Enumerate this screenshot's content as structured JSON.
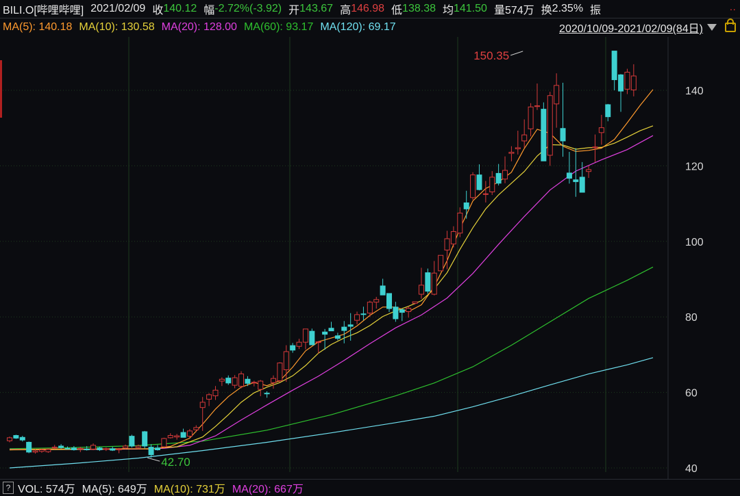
{
  "header": {
    "symbol": "BILI.O[哔哩哔哩]",
    "date": "2021/02/09",
    "close_label": "收",
    "close_value": "140.12",
    "change_label": "幅",
    "change_value": "-2.72%(-3.92)",
    "open_label": "开",
    "open_value": "143.67",
    "high_label": "高",
    "high_value": "146.98",
    "low_label": "低",
    "low_value": "138.38",
    "avg_label": "均",
    "avg_value": "141.50",
    "volume_label": "量",
    "volume_value": "574万",
    "turnover_label": "换",
    "turnover_value": "2.35%",
    "amplitude_label": "振",
    "more_dots": "··"
  },
  "ma_legend": {
    "ma5": "MA(5): 140.18",
    "ma10": "MA(10): 130.58",
    "ma20": "MA(20): 128.00",
    "ma60": "MA(60): 93.17",
    "ma120": "MA(120): 69.17",
    "range": "2020/10/09-2021/02/09(84日)"
  },
  "volume_legend": {
    "help": "?",
    "vol": "VOL: 574万",
    "ma5": "MA(5): 649万",
    "ma10": "MA(10): 731万",
    "ma20": "MA(20): 667万"
  },
  "colors": {
    "up": "#d63a3a",
    "down": "#3ed0d0",
    "ma5": "#ff9a2e",
    "ma10": "#e6d23a",
    "ma20": "#e040e0",
    "ma60": "#2ec02e",
    "ma120": "#70e0f0",
    "label_green": "#3cc63c",
    "label_red": "#e04040",
    "grid": "#1f3a1f"
  },
  "chart_data": {
    "type": "candlestick",
    "ylim": [
      39,
      150.5
    ],
    "yticks": [
      40,
      60,
      80,
      100,
      120,
      140
    ],
    "annotations": [
      {
        "text": "150.35",
        "value": 150.35,
        "index": 80
      },
      {
        "text": "42.70",
        "value": 42.7,
        "index": 21
      }
    ],
    "candles": [
      [
        47.2,
        48.3,
        46.8,
        48.0
      ],
      [
        48.6,
        48.8,
        47.7,
        47.9
      ],
      [
        48.1,
        48.5,
        47.0,
        47.4
      ],
      [
        46.8,
        47.0,
        43.9,
        44.2
      ],
      [
        44.2,
        45.0,
        43.8,
        44.5
      ],
      [
        44.4,
        45.1,
        44.0,
        44.8
      ],
      [
        44.3,
        45.2,
        44.0,
        44.9
      ],
      [
        45.3,
        46.1,
        45.0,
        45.5
      ],
      [
        45.8,
        46.3,
        45.1,
        45.4
      ],
      [
        45.2,
        45.7,
        44.9,
        45.1
      ],
      [
        45.3,
        45.8,
        44.6,
        44.8
      ],
      [
        45.0,
        45.6,
        44.2,
        45.2
      ],
      [
        45.0,
        45.8,
        44.6,
        44.8
      ],
      [
        45.0,
        46.5,
        44.7,
        46.0
      ],
      [
        45.3,
        45.6,
        44.5,
        44.8
      ],
      [
        44.9,
        45.4,
        44.5,
        45.1
      ],
      [
        45.1,
        45.6,
        44.5,
        44.7
      ],
      [
        44.8,
        45.3,
        43.9,
        45.0
      ],
      [
        45.3,
        46.2,
        45.0,
        45.8
      ],
      [
        48.4,
        48.8,
        45.4,
        45.8
      ],
      [
        45.4,
        46.2,
        45.0,
        45.8
      ],
      [
        49.6,
        49.8,
        45.2,
        45.8
      ],
      [
        45.5,
        46.3,
        42.7,
        43.5
      ],
      [
        45.3,
        46.1,
        44.6,
        44.8
      ],
      [
        45.6,
        48.0,
        45.3,
        47.8
      ],
      [
        48.0,
        49.2,
        47.8,
        48.6
      ],
      [
        48.2,
        49.0,
        47.5,
        48.5
      ],
      [
        49.4,
        50.4,
        48.4,
        48.1
      ],
      [
        48.4,
        50.3,
        48.0,
        49.8
      ],
      [
        50.1,
        51.3,
        49.5,
        50.7
      ],
      [
        56.0,
        58.8,
        49.8,
        57.4
      ],
      [
        58.2,
        59.8,
        56.4,
        59.4
      ],
      [
        59.1,
        61.7,
        58.0,
        60.6
      ],
      [
        63.0,
        64.0,
        61.7,
        63.5
      ],
      [
        63.8,
        64.5,
        62.0,
        62.5
      ],
      [
        61.9,
        64.6,
        61.1,
        63.9
      ],
      [
        61.6,
        65.6,
        61.1,
        64.9
      ],
      [
        63.5,
        64.3,
        61.7,
        62.4
      ],
      [
        62.7,
        63.1,
        61.6,
        62.7
      ],
      [
        60.8,
        63.3,
        59.0,
        63.0
      ],
      [
        59.8,
        60.3,
        58.6,
        59.7
      ],
      [
        62.6,
        64.5,
        61.0,
        63.7
      ],
      [
        63.1,
        68.0,
        62.7,
        67.8
      ],
      [
        66.0,
        72.5,
        62.8,
        70.8
      ],
      [
        72.4,
        73.1,
        70.5,
        71.2
      ],
      [
        72.2,
        74.2,
        71.5,
        73.3
      ],
      [
        73.3,
        76.8,
        71.4,
        76.8
      ],
      [
        76.2,
        76.9,
        72.6,
        72.6
      ],
      [
        73.4,
        73.6,
        70.3,
        73.4
      ],
      [
        76.0,
        76.8,
        71.3,
        75.4
      ],
      [
        77.0,
        78.7,
        76.3,
        76.3
      ],
      [
        75.0,
        75.8,
        73.8,
        74.3
      ],
      [
        77.3,
        78.9,
        73.0,
        76.4
      ],
      [
        77.9,
        81.0,
        73.7,
        77.5
      ],
      [
        79.1,
        81.4,
        78.0,
        80.6
      ],
      [
        80.8,
        82.7,
        79.1,
        80.7
      ],
      [
        81.0,
        84.3,
        80.0,
        83.9
      ],
      [
        83.9,
        85.3,
        82.2,
        84.6
      ],
      [
        88.2,
        90.1,
        86.1,
        85.8
      ],
      [
        86.2,
        86.2,
        81.3,
        82.2
      ],
      [
        82.6,
        84.0,
        78.7,
        79.5
      ],
      [
        81.9,
        82.2,
        78.9,
        81.2
      ],
      [
        81.4,
        82.8,
        79.8,
        82.3
      ],
      [
        83.6,
        83.9,
        83.3,
        84.0
      ],
      [
        86.0,
        93.0,
        84.8,
        88.4
      ],
      [
        91.7,
        92.8,
        86.1,
        86.8
      ],
      [
        86.0,
        94.8,
        85.7,
        91.6
      ],
      [
        92.2,
        96.3,
        92.7,
        96.3
      ],
      [
        97.7,
        102.8,
        92.6,
        100.7
      ],
      [
        99.3,
        104.0,
        98.4,
        102.6
      ],
      [
        102.2,
        109.0,
        101.1,
        107.5
      ],
      [
        110.2,
        113.4,
        106.0,
        108.6
      ],
      [
        111.6,
        118.3,
        111.0,
        117.6
      ],
      [
        117.6,
        120.4,
        113.5,
        113.7
      ],
      [
        112.5,
        116.0,
        110.3,
        112.6
      ],
      [
        113.1,
        118.6,
        112.3,
        117.0
      ],
      [
        118.0,
        120.5,
        114.8,
        115.4
      ],
      [
        116.5,
        122.5,
        115.4,
        118.8
      ],
      [
        123.3,
        125.2,
        121.2,
        123.6
      ],
      [
        124.5,
        129.3,
        123.0,
        124.8
      ],
      [
        126.6,
        132.3,
        124.8,
        128.2
      ],
      [
        129.8,
        136.6,
        127.8,
        135.6
      ],
      [
        135.7,
        141.8,
        134.8,
        135.9
      ],
      [
        135.0,
        136.8,
        121.4,
        121.3
      ],
      [
        122.8,
        139.6,
        120.0,
        138.6
      ],
      [
        136.4,
        144.5,
        130.1,
        141.3
      ],
      [
        129.9,
        142.0,
        122.4,
        126.6
      ],
      [
        118.1,
        123.7,
        115.3,
        116.7
      ],
      [
        116.3,
        124.7,
        111.8,
        115.8
      ],
      [
        117.0,
        121.0,
        113.8,
        113.0
      ],
      [
        118.5,
        120.0,
        116.8,
        119.0
      ],
      [
        124.8,
        128.3,
        121.0,
        125.0
      ],
      [
        128.8,
        133.5,
        125.6,
        130.1
      ],
      [
        136.2,
        136.4,
        131.8,
        133.0
      ],
      [
        150.4,
        149.4,
        140.0,
        142.8
      ],
      [
        144.1,
        144.3,
        134.3,
        139.8
      ],
      [
        140.3,
        145.7,
        139.0,
        144.8
      ],
      [
        140.1,
        146.9,
        138.4,
        143.8
      ]
    ],
    "ma5": [
      [
        0,
        44.8
      ],
      [
        6,
        45.0
      ],
      [
        12,
        45.0
      ],
      [
        18,
        45.1
      ],
      [
        22,
        45.0
      ],
      [
        25,
        45.7
      ],
      [
        28,
        47.9
      ],
      [
        30,
        51.6
      ],
      [
        32,
        55.6
      ],
      [
        34,
        58.9
      ],
      [
        36,
        61.4
      ],
      [
        38,
        62.6
      ],
      [
        40,
        61.8
      ],
      [
        42,
        63.1
      ],
      [
        44,
        66.7
      ],
      [
        46,
        71.0
      ],
      [
        48,
        73.4
      ],
      [
        50,
        74.4
      ],
      [
        52,
        75.4
      ],
      [
        54,
        77.6
      ],
      [
        56,
        80.4
      ],
      [
        58,
        82.6
      ],
      [
        60,
        82.6
      ],
      [
        62,
        81.4
      ],
      [
        64,
        83.2
      ],
      [
        66,
        88.0
      ],
      [
        68,
        94.9
      ],
      [
        70,
        103.4
      ],
      [
        72,
        110.7
      ],
      [
        74,
        114.0
      ],
      [
        76,
        115.7
      ],
      [
        78,
        118.3
      ],
      [
        80,
        124.6
      ],
      [
        82,
        129.7
      ],
      [
        84,
        128.6
      ],
      [
        86,
        125.2
      ],
      [
        88,
        123.8
      ],
      [
        90,
        124.1
      ],
      [
        92,
        124.7
      ],
      [
        94,
        127.0
      ],
      [
        96,
        131.4
      ],
      [
        98,
        136.0
      ],
      [
        100,
        140.2
      ]
    ],
    "ma10": [
      [
        0,
        44.8
      ],
      [
        8,
        44.9
      ],
      [
        16,
        45.0
      ],
      [
        22,
        45.1
      ],
      [
        26,
        45.6
      ],
      [
        30,
        48.2
      ],
      [
        32,
        51.0
      ],
      [
        34,
        54.1
      ],
      [
        36,
        57.4
      ],
      [
        38,
        59.9
      ],
      [
        40,
        61.4
      ],
      [
        42,
        62.6
      ],
      [
        44,
        64.4
      ],
      [
        46,
        67.1
      ],
      [
        48,
        70.4
      ],
      [
        50,
        72.7
      ],
      [
        52,
        74.4
      ],
      [
        54,
        75.8
      ],
      [
        56,
        77.7
      ],
      [
        58,
        80.1
      ],
      [
        60,
        81.6
      ],
      [
        62,
        82.8
      ],
      [
        64,
        84.3
      ],
      [
        66,
        87.4
      ],
      [
        68,
        91.7
      ],
      [
        70,
        97.9
      ],
      [
        72,
        103.6
      ],
      [
        74,
        108.6
      ],
      [
        76,
        112.3
      ],
      [
        78,
        115.4
      ],
      [
        80,
        118.5
      ],
      [
        82,
        122.6
      ],
      [
        84,
        125.6
      ],
      [
        86,
        125.5
      ],
      [
        88,
        124.4
      ],
      [
        90,
        124.8
      ],
      [
        92,
        124.9
      ],
      [
        94,
        126.0
      ],
      [
        96,
        127.6
      ],
      [
        98,
        129.3
      ],
      [
        100,
        130.6
      ]
    ],
    "ma20": [
      [
        0,
        44.9
      ],
      [
        10,
        44.9
      ],
      [
        20,
        45.0
      ],
      [
        24,
        45.2
      ],
      [
        28,
        46.0
      ],
      [
        32,
        48.5
      ],
      [
        36,
        52.7
      ],
      [
        40,
        56.7
      ],
      [
        44,
        60.6
      ],
      [
        48,
        64.3
      ],
      [
        52,
        68.5
      ],
      [
        56,
        72.9
      ],
      [
        60,
        77.1
      ],
      [
        64,
        80.5
      ],
      [
        68,
        85.0
      ],
      [
        72,
        91.5
      ],
      [
        76,
        99.2
      ],
      [
        80,
        106.6
      ],
      [
        84,
        113.6
      ],
      [
        88,
        118.6
      ],
      [
        92,
        121.6
      ],
      [
        96,
        124.3
      ],
      [
        100,
        128.0
      ]
    ],
    "ma60": [
      [
        0,
        45.1
      ],
      [
        10,
        45.4
      ],
      [
        20,
        45.9
      ],
      [
        30,
        47.1
      ],
      [
        40,
        50.0
      ],
      [
        50,
        54.1
      ],
      [
        60,
        59.1
      ],
      [
        66,
        62.5
      ],
      [
        72,
        66.8
      ],
      [
        78,
        72.5
      ],
      [
        84,
        78.7
      ],
      [
        90,
        84.9
      ],
      [
        96,
        89.7
      ],
      [
        100,
        93.2
      ]
    ],
    "ma120": [
      [
        0,
        40.0
      ],
      [
        10,
        41.2
      ],
      [
        20,
        42.6
      ],
      [
        30,
        44.6
      ],
      [
        40,
        46.8
      ],
      [
        50,
        49.3
      ],
      [
        60,
        52.0
      ],
      [
        66,
        53.7
      ],
      [
        72,
        56.2
      ],
      [
        78,
        59.0
      ],
      [
        84,
        62.0
      ],
      [
        90,
        64.9
      ],
      [
        96,
        67.3
      ],
      [
        100,
        69.2
      ]
    ]
  }
}
